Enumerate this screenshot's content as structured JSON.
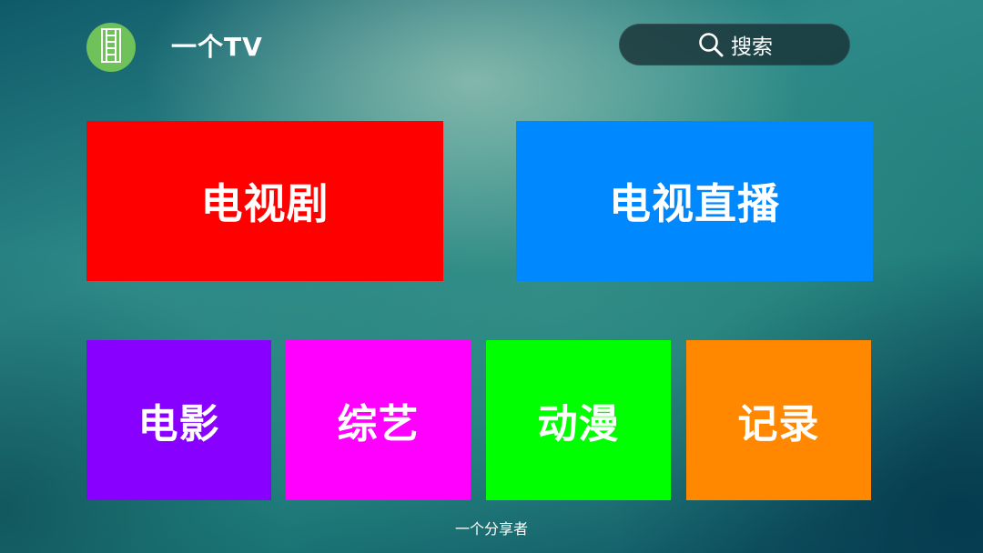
{
  "header": {
    "app_logo_icon": "film-strip-icon",
    "app_title": "一个TV",
    "search": {
      "icon": "search-icon",
      "label": "搜索"
    }
  },
  "tiles": {
    "tv_series": {
      "label": "电视剧",
      "color": "#ff0000"
    },
    "tv_live": {
      "label": "电视直播",
      "color": "#0088ff"
    },
    "movies": {
      "label": "电影",
      "color": "#8800ff"
    },
    "variety": {
      "label": "综艺",
      "color": "#ff00ff"
    },
    "anime": {
      "label": "动漫",
      "color": "#00ff00"
    },
    "documentary": {
      "label": "记录",
      "color": "#ff8800"
    }
  },
  "footer": {
    "text": "一个分享者"
  },
  "colors": {
    "logo_green": "#6fc25a",
    "search_bg": "#1f3a3e"
  }
}
